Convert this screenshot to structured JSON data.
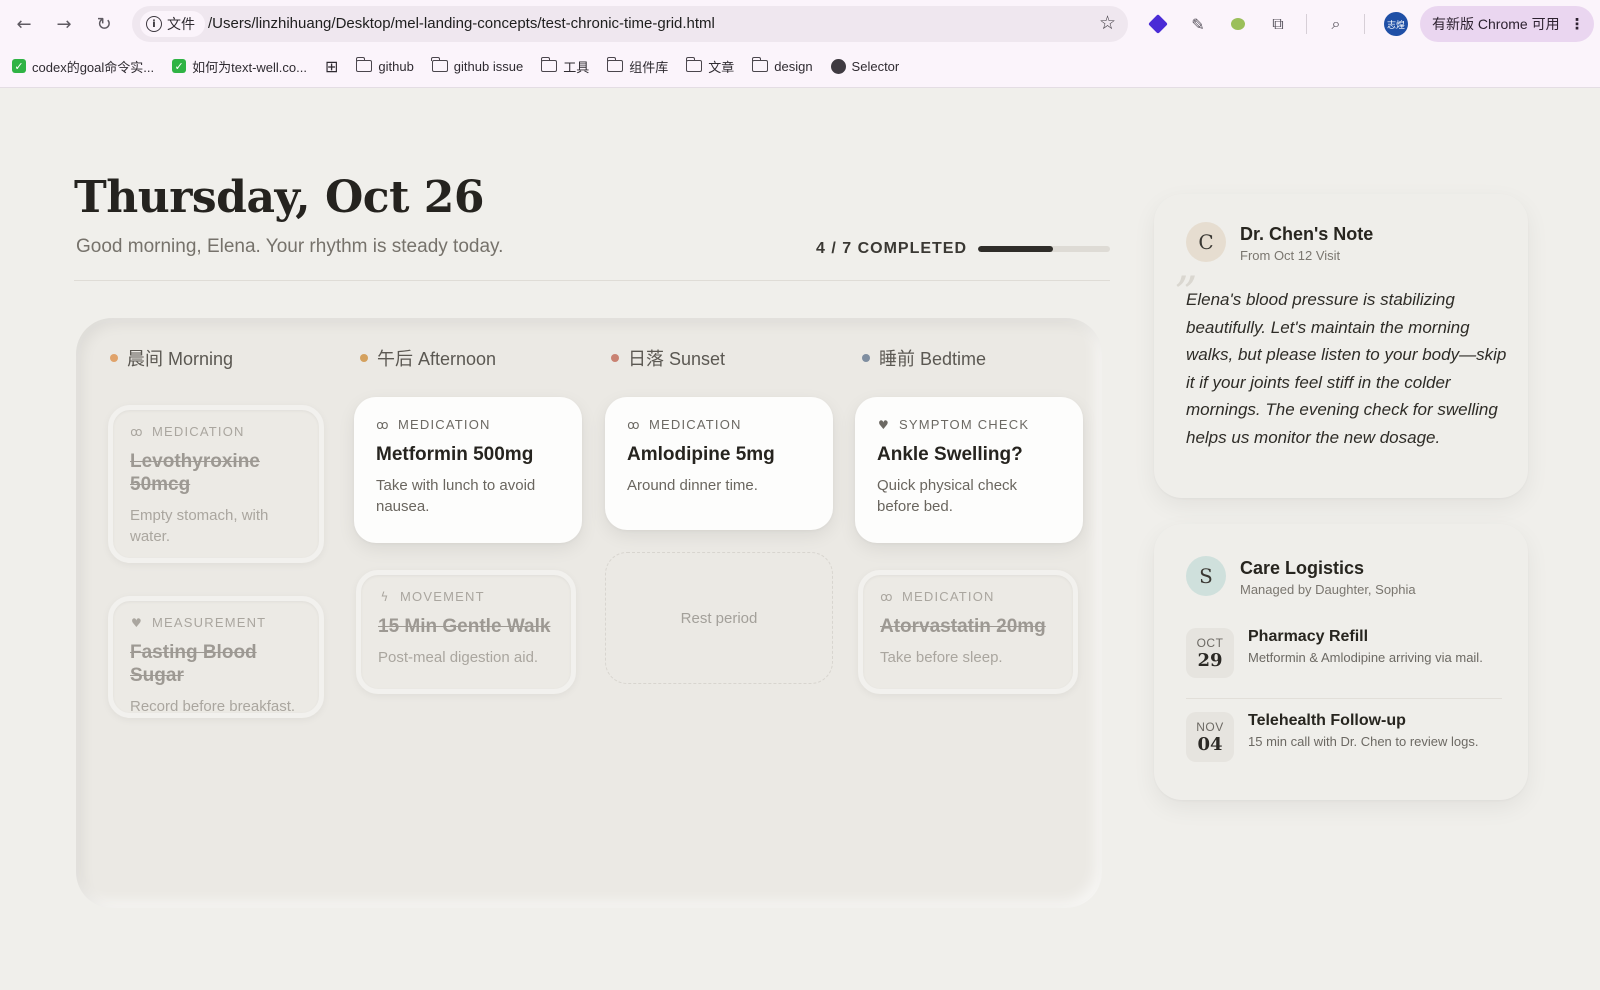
{
  "browser": {
    "site_chip_label": "文件",
    "url": "/Users/linzhihuang/Desktop/mel-landing-concepts/test-chronic-time-grid.html",
    "profile_label": "志煌",
    "update_label": "有新版 Chrome 可用",
    "bookmarks": [
      {
        "label": "codex的goal命令实..."
      },
      {
        "label": "如何为text-well.co..."
      },
      {
        "label": "github"
      },
      {
        "label": "github issue"
      },
      {
        "label": "工具"
      },
      {
        "label": "组件库"
      },
      {
        "label": "文章"
      },
      {
        "label": "design"
      },
      {
        "label": "Selector"
      }
    ]
  },
  "header": {
    "title": "Thursday, Oct 26",
    "greeting": "Good morning, Elena. Your rhythm is steady today.",
    "progress_label": "4 / 7 COMPLETED",
    "progress_fraction": 0.57
  },
  "columns": [
    {
      "label": "晨间 Morning",
      "dot_color": "#e0a36b"
    },
    {
      "label": "午后 Afternoon",
      "dot_color": "#d4a15e"
    },
    {
      "label": "日落 Sunset",
      "dot_color": "#c98272"
    },
    {
      "label": "睡前 Bedtime",
      "dot_color": "#7f8ea0"
    }
  ],
  "cards": {
    "morning_1": {
      "category": "MEDICATION",
      "title": "Levothyroxine 50mcg",
      "desc": "Empty stomach, with water.",
      "state": "completed"
    },
    "morning_2": {
      "category": "MEASUREMENT",
      "title": "Fasting Blood Sugar",
      "desc": "Record before breakfast.",
      "state": "completed"
    },
    "afternoon_1": {
      "category": "MEDICATION",
      "title": "Metformin 500mg",
      "desc": "Take with lunch to avoid nausea.",
      "state": "pending"
    },
    "afternoon_2": {
      "category": "MOVEMENT",
      "title": "15 Min Gentle Walk",
      "desc": "Post-meal digestion aid.",
      "state": "completed"
    },
    "sunset_1": {
      "category": "MEDICATION",
      "title": "Amlodipine 5mg",
      "desc": "Around dinner time.",
      "state": "pending"
    },
    "sunset_rest": {
      "label": "Rest period"
    },
    "bedtime_1": {
      "category": "SYMPTOM CHECK",
      "title": "Ankle Swelling?",
      "desc": "Quick physical check before bed.",
      "state": "pending"
    },
    "bedtime_2": {
      "category": "MEDICATION",
      "title": "Atorvastatin 20mg",
      "desc": "Take before sleep.",
      "state": "completed"
    }
  },
  "doctor_note": {
    "avatar_letter": "C",
    "title": "Dr. Chen's Note",
    "subtitle": "From Oct 12 Visit",
    "quote_mark": "”",
    "text": "Elena's blood pressure is stabilizing beautifully. Let's maintain the morning walks, but please listen to your body—skip it if your joints feel stiff in the colder mornings. The evening check for swelling helps us monitor the new dosage."
  },
  "care_logistics": {
    "avatar_letter": "S",
    "title": "Care Logistics",
    "subtitle": "Managed by Daughter, Sophia",
    "items": [
      {
        "month": "OCT",
        "day": "29",
        "title": "Pharmacy Refill",
        "desc": "Metformin & Amlodipine arriving via mail."
      },
      {
        "month": "NOV",
        "day": "04",
        "title": "Telehealth Follow-up",
        "desc": "15 min call with Dr. Chen to review logs."
      }
    ]
  }
}
